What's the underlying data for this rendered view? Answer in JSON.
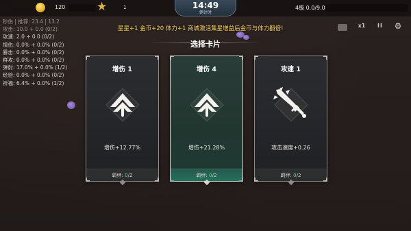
{
  "topbar": {
    "coin_value": "120",
    "star_value": "1",
    "level_text": "4级 0.0/9.0",
    "timer": "14:49",
    "timer_label": "倒计时"
  },
  "notice": "星星+1 金币+20 体力+1 商城激活集星增益后金币与体力翻倍!",
  "controls": {
    "speed": "x1",
    "pause": "II"
  },
  "stats": [
    {
      "text": "秒伤 | 推荐: 23.4 | 13.2"
    },
    {
      "text": "攻击: 10.0 + 0.0  (0/2)"
    },
    {
      "text": "攻速: 2.0 + 0.0  (0/2)"
    },
    {
      "text": "增伤: 0.0% + 0.0%  (0/2)"
    },
    {
      "text": "暴击: 0.0% + 0.0%  (0/2)"
    },
    {
      "text": "群攻: 0.0% + 0.0%  (0/2)"
    },
    {
      "text": "弹射: 17.0% + 0.0%  (1/2)"
    },
    {
      "text": "经验: 0.0% + 0.0%  (0/2)"
    },
    {
      "text": "祈福: 6.4% + 0.0%  (1/2)"
    }
  ],
  "modal": {
    "title": "选择卡片",
    "cards": [
      {
        "title": "增伤 1",
        "icon": "arrow-up-chevron-icon",
        "desc": "增伤+12.77%",
        "bond_label": "羁绊:",
        "bond_current": "0",
        "bond_total": "/2",
        "selected": false
      },
      {
        "title": "增伤 4",
        "icon": "arrow-up-chevron-icon",
        "desc": "增伤+21.28%",
        "bond_label": "羁绊:",
        "bond_current": "0",
        "bond_total": "/2",
        "selected": true
      },
      {
        "title": "攻速 1",
        "icon": "sword-icon",
        "desc": "攻击速度+0.26",
        "bond_label": "羁绊:",
        "bond_current": "0",
        "bond_total": "/2",
        "selected": false
      }
    ]
  },
  "colors": {
    "accent_gold": "#ffd86a",
    "bond_green": "#6bdc8a",
    "selected_card": "#223630"
  }
}
